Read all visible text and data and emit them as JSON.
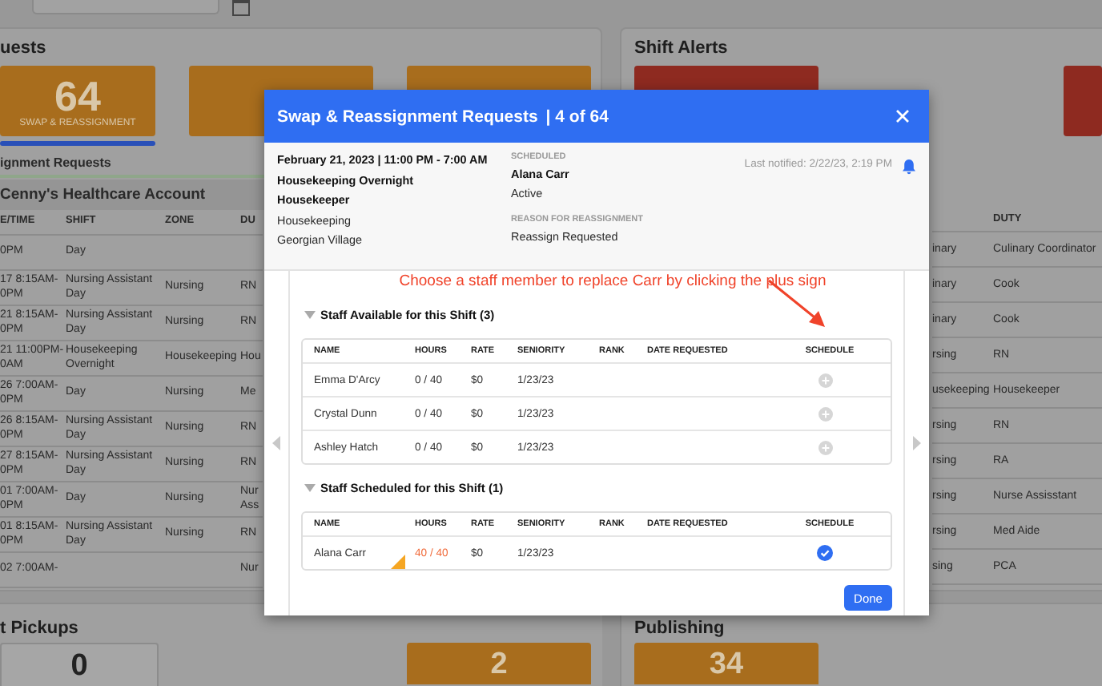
{
  "requests_panel": {
    "title": "uests",
    "cards": [
      {
        "value": "64",
        "label": "SWAP & REASSIGNMENT",
        "selected": true
      },
      {
        "selected": false
      }
    ],
    "tab_label": "ignment Requests",
    "table": {
      "account": "Cenny's Healthcare Account",
      "columns": [
        "E/TIME",
        "SHIFT",
        "ZONE",
        "DU"
      ],
      "rows": [
        {
          "datetime": "0PM",
          "shift": "Day"
        },
        {
          "datetime": "17 8:15AM- 0PM",
          "shift": "Nursing Assistant Day",
          "zone": "Nursing",
          "duty": "RN"
        },
        {
          "datetime": "21 8:15AM- 0PM",
          "shift": "Nursing Assistant Day",
          "zone": "Nursing",
          "duty": "RN"
        },
        {
          "datetime": "21 11:00PM- 0AM",
          "shift": "Housekeeping Overnight",
          "zone": "Housekeeping",
          "duty": "Hou"
        },
        {
          "datetime": "26 7:00AM- 0PM",
          "shift": "Day",
          "zone": "Nursing",
          "duty": "Me"
        },
        {
          "datetime": "26 8:15AM- 0PM",
          "shift": "Nursing Assistant Day",
          "zone": "Nursing",
          "duty": "RN"
        },
        {
          "datetime": "27 8:15AM- 0PM",
          "shift": "Nursing Assistant Day",
          "zone": "Nursing",
          "duty": "RN"
        },
        {
          "datetime": "01 7:00AM- 0PM",
          "shift": "Day",
          "zone": "Nursing",
          "duty": "Nur Ass"
        },
        {
          "datetime": "01 8:15AM- 0PM",
          "shift": "Nursing Assistant Day",
          "zone": "Nursing",
          "duty": "RN"
        },
        {
          "datetime": "02 7:00AM-",
          "duty": "Nur"
        }
      ]
    }
  },
  "alerts_panel": {
    "title": "Shift Alerts",
    "table": {
      "columns": [
        "DUTY"
      ],
      "rows": [
        {
          "zone": "inary",
          "duty": "Culinary Coordinator"
        },
        {
          "zone": "inary",
          "duty": "Cook"
        },
        {
          "zone": "inary",
          "duty": "Cook"
        },
        {
          "zone": "rsing",
          "duty": "RN"
        },
        {
          "zone": "usekeeping",
          "duty": "Housekeeper"
        },
        {
          "zone": "rsing",
          "duty": "RN"
        },
        {
          "zone": "rsing",
          "duty": "RA"
        },
        {
          "zone": "rsing",
          "duty": "Nurse Assisstant"
        },
        {
          "zone": "rsing",
          "duty": "Med Aide"
        },
        {
          "zone": "sing",
          "duty": "PCA"
        }
      ]
    }
  },
  "pickups_panel": {
    "title": "t Pickups",
    "cards": [
      {
        "value": "0"
      },
      {
        "value": "2"
      }
    ]
  },
  "publishing_panel": {
    "title": "Publishing",
    "cards": [
      {
        "value": "34"
      }
    ]
  },
  "modal": {
    "title": "Swap & Reassignment Requests",
    "counter": "| 4 of 64",
    "details": {
      "lines": [
        {
          "text": "February 21, 2023 | 11:00 PM - 7:00 AM",
          "bold": true
        },
        {
          "text": "Housekeeping Overnight",
          "bold": true
        },
        {
          "text": "Housekeeper",
          "bold": true
        },
        {
          "text": "Housekeeping",
          "bold": false
        },
        {
          "text": "Georgian Village",
          "bold": false
        }
      ],
      "scheduled_label": "SCHEDULED",
      "scheduled_name": "Alana Carr",
      "scheduled_status": "Active",
      "reason_label": "REASON FOR REASSIGNMENT",
      "reason": "Reassign Requested",
      "last_notified": "Last notified: 2/22/23, 2:19 PM"
    },
    "annotation": "Choose a staff member to replace Carr by clicking the plus sign",
    "sections": [
      {
        "title": "Staff Available for this Shift (3)",
        "expanded": true,
        "columns": [
          "NAME",
          "HOURS",
          "RATE",
          "SENIORITY",
          "RANK",
          "DATE REQUESTED",
          "SCHEDULE"
        ],
        "rows": [
          {
            "name": "Emma D'Arcy",
            "hours": "0 / 40",
            "over_limit": false,
            "rate": "$0",
            "seniority": "1/23/23",
            "scheduled": false
          },
          {
            "name": "Crystal Dunn",
            "hours": "0 / 40",
            "over_limit": false,
            "rate": "$0",
            "seniority": "1/23/23",
            "scheduled": false
          },
          {
            "name": "Ashley Hatch",
            "hours": "0 / 40",
            "over_limit": false,
            "rate": "$0",
            "seniority": "1/23/23",
            "scheduled": false
          }
        ]
      },
      {
        "title": "Staff Scheduled for this Shift (1)",
        "expanded": true,
        "columns": [
          "NAME",
          "HOURS",
          "RATE",
          "SENIORITY",
          "RANK",
          "DATE REQUESTED",
          "SCHEDULE"
        ],
        "rows": [
          {
            "name": "Alana Carr",
            "hours": "40 / 40",
            "over_limit": true,
            "rate": "$0",
            "seniority": "1/23/23",
            "scheduled": true
          }
        ]
      }
    ],
    "done_button": "Done"
  }
}
